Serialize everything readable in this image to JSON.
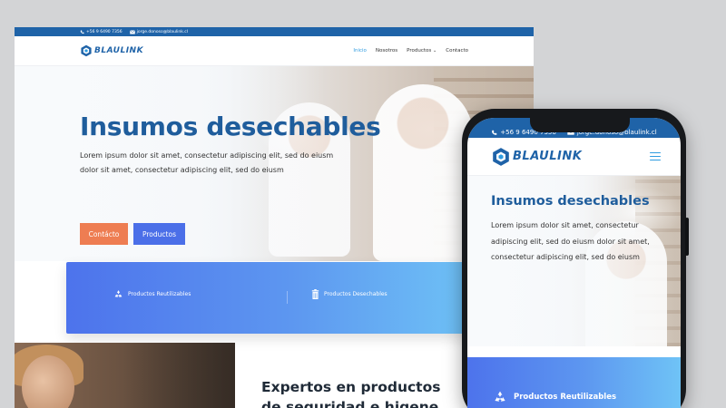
{
  "contact": {
    "phone": "+56 9 6490 7356",
    "email": "jorge.donoso@blaulink.cl"
  },
  "brand": {
    "logo_text": "BLAULINK",
    "primary_color": "#1f63a8",
    "accent_color": "#2e9be0",
    "orange": "#ee7d52",
    "blue_button": "#4b6fe8"
  },
  "nav": {
    "items": [
      {
        "label": "Inicio",
        "active": true
      },
      {
        "label": "Nosotros",
        "active": false
      },
      {
        "label": "Productos",
        "active": false,
        "dropdown": true
      },
      {
        "label": "Contacto",
        "active": false
      }
    ],
    "dropdown_icon": "chevron-down-icon",
    "mobile_menu_icon": "hamburger-icon"
  },
  "hero": {
    "title": "Insumos desechables",
    "desktop_paragraph": "Lorem ipsum dolor sit amet, consectetur adipiscing elit, sed do eiusm dolor sit amet, consectetur adipiscing elit, sed do eiusm",
    "mobile_paragraph": "Lorem ipsum dolor sit amet, consectetur adipiscing elit, sed do eiusm dolor sit amet, consectetur adipiscing elit, sed do eiusm",
    "button_contact": "Contácto",
    "button_products": "Productos"
  },
  "features": {
    "reusable": {
      "label": "Productos Reutilizables",
      "icon": "recycle-icon"
    },
    "disposable": {
      "label": "Productos Desechables",
      "icon": "trash-icon"
    }
  },
  "section": {
    "heading": "Expertos en productos de seguridad e higene"
  }
}
